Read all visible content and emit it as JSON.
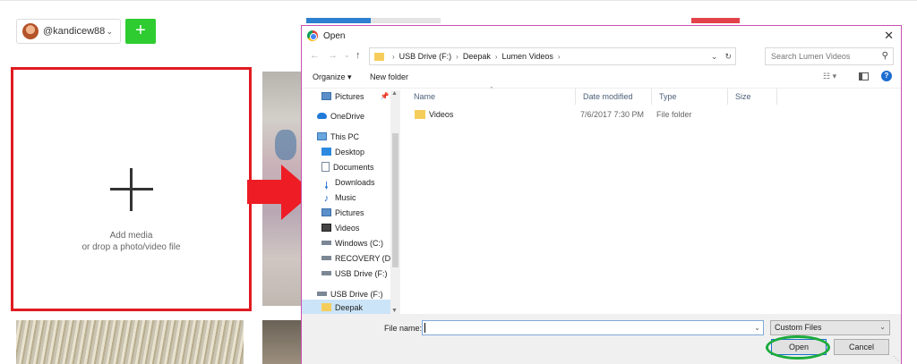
{
  "app": {
    "username": "@kandicew88",
    "add_button": "+",
    "add_media_line1": "Add media",
    "add_media_line2": "or drop a photo/video file"
  },
  "dialog": {
    "title": "Open",
    "breadcrumb": [
      "USB Drive (F:)",
      "Deepak",
      "Lumen Videos"
    ],
    "search_placeholder": "Search Lumen Videos",
    "toolbar": {
      "organize": "Organize ▾",
      "new_folder": "New folder"
    },
    "nav_items": [
      {
        "label": "Pictures",
        "icon": "pictures-icon",
        "pinned": true
      },
      {
        "label": "OneDrive",
        "icon": "onedrive-icon"
      },
      {
        "label": "This PC",
        "icon": "this-pc-icon"
      },
      {
        "label": "Desktop",
        "icon": "desktop-icon"
      },
      {
        "label": "Documents",
        "icon": "documents-icon"
      },
      {
        "label": "Downloads",
        "icon": "downloads-icon"
      },
      {
        "label": "Music",
        "icon": "music-icon"
      },
      {
        "label": "Pictures",
        "icon": "pictures-icon"
      },
      {
        "label": "Videos",
        "icon": "videos-icon"
      },
      {
        "label": "Windows (C:)",
        "icon": "drive-icon"
      },
      {
        "label": "RECOVERY (D:)",
        "icon": "drive-icon"
      },
      {
        "label": "USB Drive (F:)",
        "icon": "usb-drive-icon"
      },
      {
        "label": "USB Drive (F:)",
        "icon": "usb-drive-icon"
      },
      {
        "label": "Deepak",
        "icon": "folder-icon",
        "selected": true
      }
    ],
    "columns": [
      "Name",
      "Date modified",
      "Type",
      "Size"
    ],
    "files": [
      {
        "name": "Videos",
        "date": "7/6/2017 7:30 PM",
        "type": "File folder",
        "size": ""
      }
    ],
    "file_name_label": "File name:",
    "file_name_value": "",
    "file_type": "Custom Files",
    "open_button": "Open",
    "cancel_button": "Cancel"
  },
  "colors": {
    "highlight_red": "#e01b22",
    "open_ring_green": "#1cab3c",
    "add_button_green": "#2ecc30",
    "selection_blue": "#cce4f7"
  }
}
